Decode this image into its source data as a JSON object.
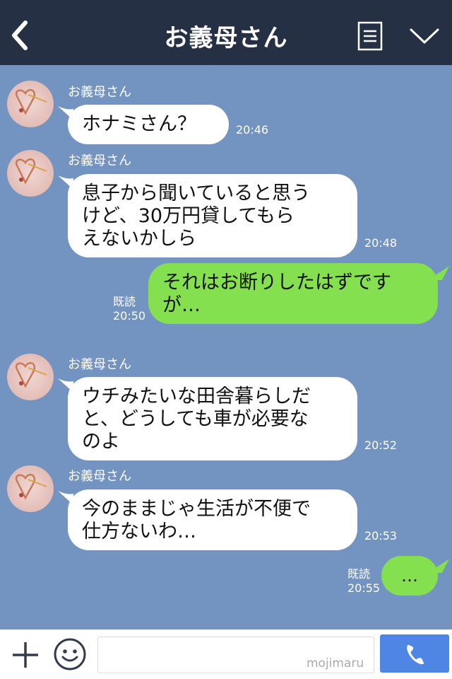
{
  "header": {
    "title": "お義母さん",
    "back_icon": "chevron-left-icon",
    "menu_icon": "menu-list-icon",
    "dropdown_icon": "chevron-down-icon"
  },
  "colors": {
    "header_bg": "#253045",
    "chat_bg": "#7393c0",
    "incoming_bubble": "#ffffff",
    "outgoing_bubble": "#84e04e",
    "call_button": "#4f86e5"
  },
  "messages": [
    {
      "sender": "お義母さん",
      "text": "ホナミさん？",
      "time": "20:46"
    },
    {
      "sender": "お義母さん",
      "text": "息子から聞いていると思う\nけど、30万円貸してもら\nえないかしら",
      "time": "20:48"
    },
    {
      "read": "既読",
      "text": "それはお断りしたはずです\nが…",
      "time": "20:50"
    },
    {
      "sender": "お義母さん",
      "text": "ウチみたいな田舎暮らしだ\nと、どうしても車が必要な\nのよ",
      "time": "20:52"
    },
    {
      "sender": "お義母さん",
      "text": "今のままじゃ生活が不便で\n仕方ないわ…",
      "time": "20:53"
    },
    {
      "read": "既読",
      "text": "…",
      "time": "20:55"
    }
  ],
  "footer": {
    "plus_icon": "plus-icon",
    "emoji_icon": "smiley-icon",
    "input_value": "",
    "watermark": "mojimaru",
    "call_icon": "phone-icon"
  }
}
